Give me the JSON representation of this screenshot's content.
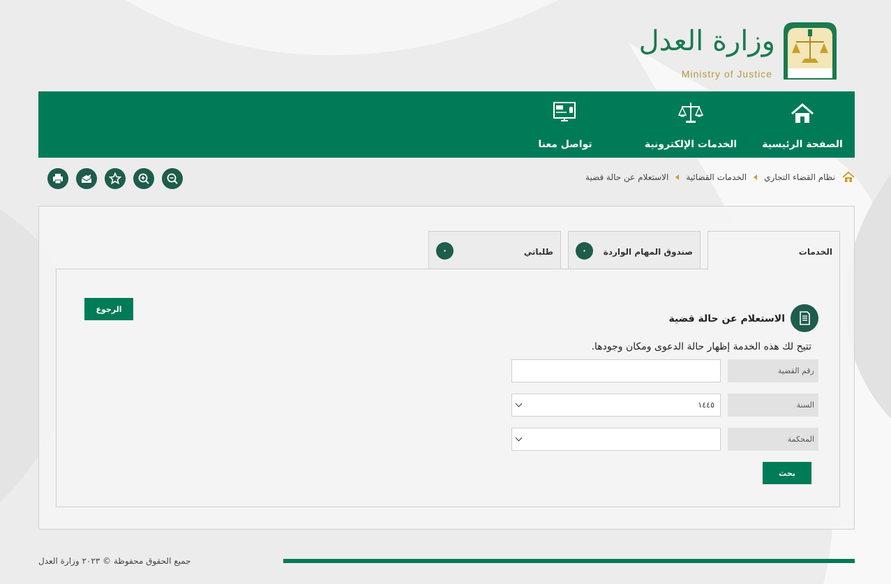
{
  "logo": {
    "arabic": "وزارة العدل",
    "english": "Ministry of Justice"
  },
  "nav": {
    "home": "الصفحة الرئيسية",
    "eservices": "الخدمات الإلكترونية",
    "contact": "تواصل معنا"
  },
  "breadcrumb": {
    "item1": "نظام القضاء التجاري",
    "item2": "الخدمات القضائية",
    "item3": "الاستعلام عن حالة قضية"
  },
  "tools": [
    "print-icon",
    "share-icon",
    "star-icon",
    "zoom-in-icon",
    "zoom-out-icon"
  ],
  "tabs": {
    "services": "الخدمات",
    "inbox": "صندوق المهام الواردة",
    "inbox_count": "٠",
    "requests": "طلباتي",
    "requests_count": "٠"
  },
  "service": {
    "back_label": "الرجوع",
    "title": "الاستعلام عن حالة قضية",
    "description": "تتيح لك هذه الخدمة إظهار حالة الدعوى ومكان وجودها.",
    "case_number_label": "رقم القضية",
    "case_number_value": "",
    "year_label": "السنة",
    "year_value": "١٤٤٥",
    "court_label": "المحكمة",
    "court_value": "",
    "search_label": "بحث"
  },
  "footer": {
    "copyright": "جميع الحقوق محفوظة © ٢٠٢٣ وزارة العدل"
  },
  "colors": {
    "primary": "#007b57",
    "dark_teal": "#1e5c4c",
    "gold": "#c8a02a"
  }
}
